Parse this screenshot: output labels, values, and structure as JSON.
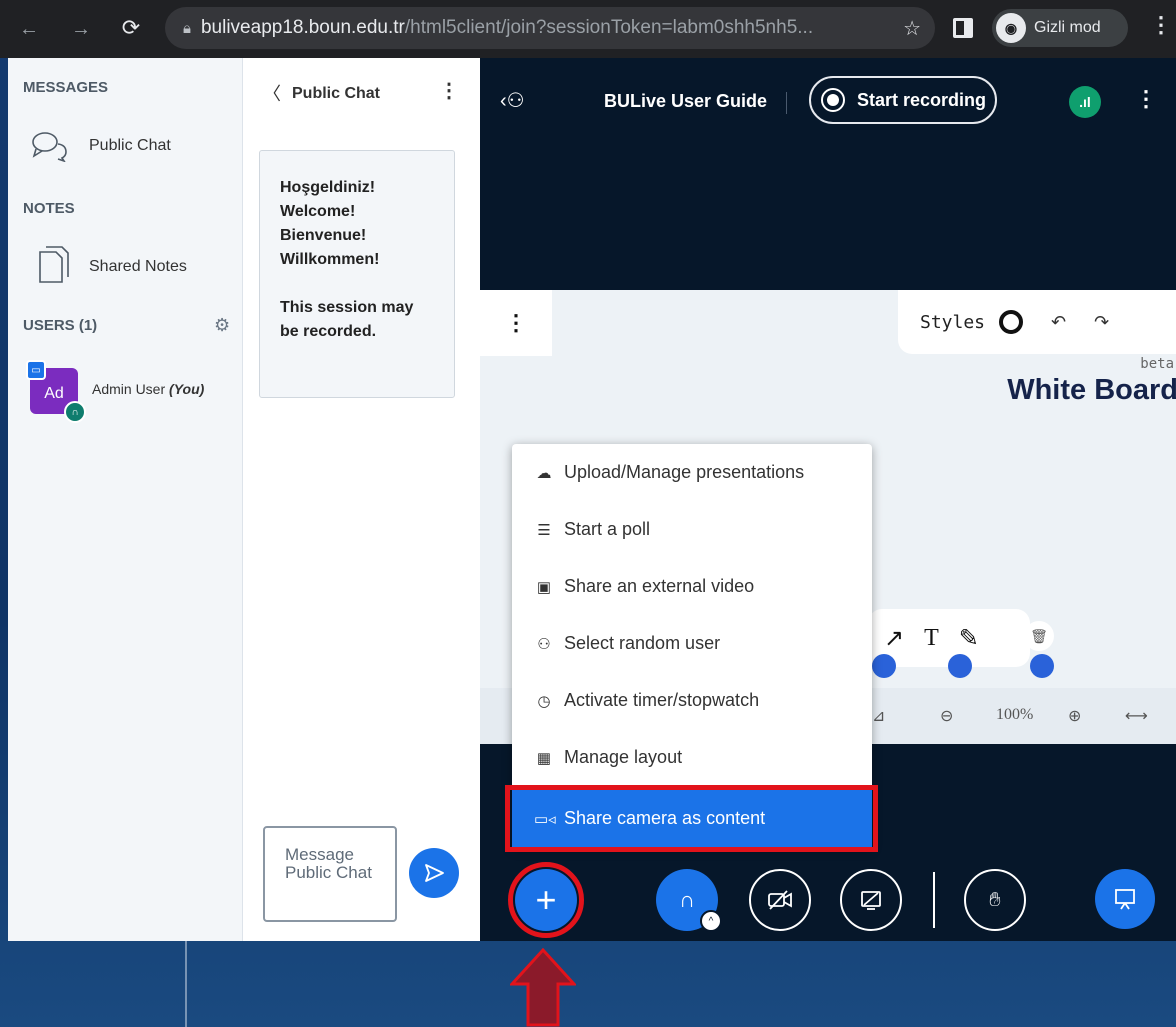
{
  "browser": {
    "url_host": "buliveapp18.boun.edu.tr",
    "url_path": "/html5client/join?sessionToken=labm0shh5nh5...",
    "profile_label": "Gizli mod"
  },
  "sidebar": {
    "messages_heading": "MESSAGES",
    "public_chat_label": "Public Chat",
    "notes_heading": "NOTES",
    "shared_notes_label": "Shared Notes",
    "users_heading": "USERS (1)",
    "user": {
      "initials": "Ad",
      "name": "Admin User",
      "you_tag": "(You)"
    }
  },
  "chat": {
    "title": "Public Chat",
    "welcome_lines": [
      "Hoşgeldiniz!",
      "Welcome!",
      "Bienvenue!",
      "Willkommen!"
    ],
    "notice": "This session may be recorded.",
    "input_placeholder": "Message Public Chat"
  },
  "header": {
    "title": "BULive User Guide",
    "record_label": "Start recording"
  },
  "whiteboard": {
    "styles_label": "Styles",
    "beta_label": "beta",
    "heading": "White Board",
    "zoom_level": "100%"
  },
  "plus_menu": {
    "items": [
      {
        "label": "Upload/Manage presentations",
        "icon": "cloud-upload-icon"
      },
      {
        "label": "Start a poll",
        "icon": "poll-icon"
      },
      {
        "label": "Share an external video",
        "icon": "video-icon"
      },
      {
        "label": "Select random user",
        "icon": "user-icon"
      },
      {
        "label": "Activate timer/stopwatch",
        "icon": "timer-icon"
      },
      {
        "label": "Manage layout",
        "icon": "layout-icon"
      },
      {
        "label": "Share camera as content",
        "icon": "camera-icon"
      }
    ],
    "active_index": 6
  },
  "colors": {
    "accent": "#1b73e8",
    "highlight": "#e2131b",
    "main_bg": "#06172a",
    "avatar": "#7b2cbf"
  }
}
